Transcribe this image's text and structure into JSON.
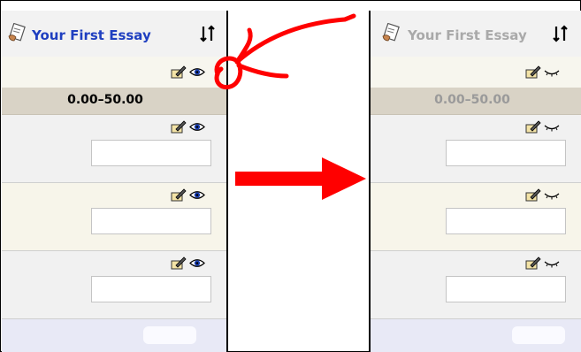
{
  "before": {
    "essay_title": "Your First Essay",
    "grade_range": "0.00–50.00",
    "eye_icon": "eye-icon",
    "grade_icon": "edit-grade-icon",
    "sort_icon": "sort-arrows-icon",
    "title_color": "#1f3fc0"
  },
  "after": {
    "essay_title": "Your First Essay",
    "grade_range": "0.00–50.00",
    "eye_icon": "eye-closed-icon",
    "grade_icon": "edit-grade-icon",
    "sort_icon": "sort-arrows-icon",
    "title_color": "#a9a9a9"
  },
  "annotation": {
    "arrow_color": "#ff0000",
    "circle_color": "#ff0000"
  }
}
